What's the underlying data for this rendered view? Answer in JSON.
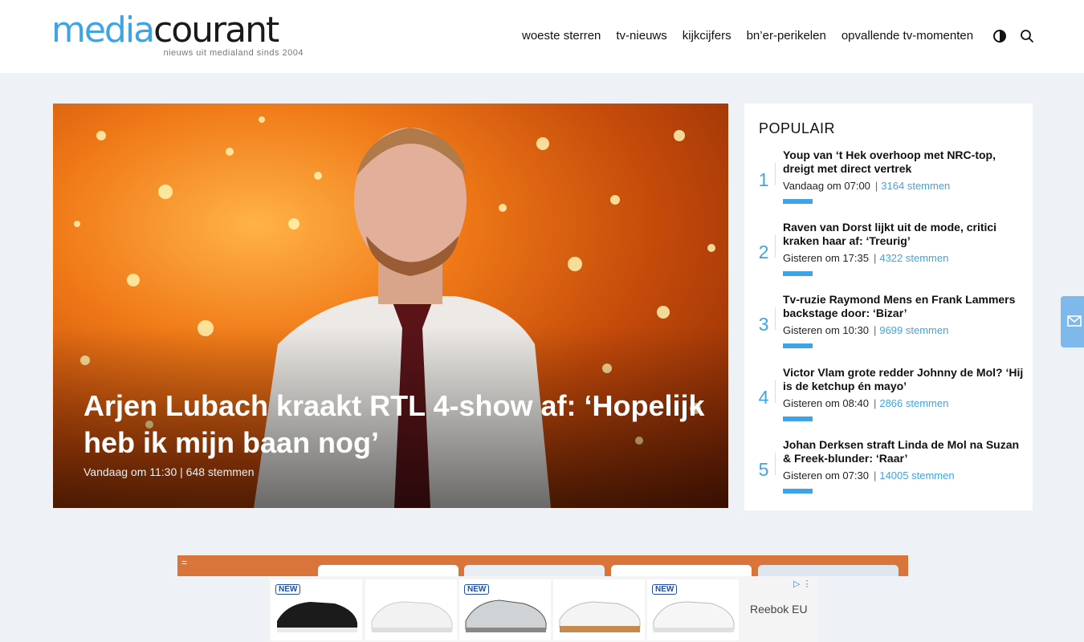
{
  "logo": {
    "part1": "media",
    "part2": "courant",
    "tagline": "nieuws uit medialand sinds 2004"
  },
  "nav": [
    "woeste sterren",
    "tv-nieuws",
    "kijkcijfers",
    "bn’er-perikelen",
    "opvallende tv-momenten"
  ],
  "icons": {
    "contrast": "contrast-toggle-icon",
    "search": "search-icon",
    "mail": "mail-icon"
  },
  "hero": {
    "title": "Arjen Lubach kraakt RTL 4-show af: ‘Hopelijk heb ik mijn baan nog’",
    "meta": "Vandaag om 11:30 | 648 stemmen"
  },
  "popular": {
    "heading": "POPULAIR",
    "items": [
      {
        "rank": "1",
        "title": "Youp van ‘t Hek overhoop met NRC-top, dreigt met direct vertrek",
        "time": "Vandaag om 07:00",
        "votes": "3164 stemmen"
      },
      {
        "rank": "2",
        "title": "Raven van Dorst lijkt uit de mode, critici kraken haar af: ‘Treurig’",
        "time": "Gisteren om 17:35",
        "votes": "4322 stemmen"
      },
      {
        "rank": "3",
        "title": "Tv-ruzie Raymond Mens en Frank Lammers backstage door: ‘Bizar’",
        "time": "Gisteren om 10:30",
        "votes": "9699 stemmen"
      },
      {
        "rank": "4",
        "title": "Victor Vlam grote redder Johnny de Mol? ‘Hij is de ketchup én mayo’",
        "time": "Gisteren om 08:40",
        "votes": "2866 stemmen"
      },
      {
        "rank": "5",
        "title": "Johan Derksen straft Linda de Mol na Suzan & Freek-blunder: ‘Raar’",
        "time": "Gisteren om 07:30",
        "votes": "14005 stemmen"
      }
    ]
  },
  "ad": {
    "brand": "Reebok EU",
    "badge": "NEW",
    "top_menu": "=",
    "choices": "▷ ⋮"
  },
  "colors": {
    "accent": "#3ea4e6",
    "ad_bg": "#d9743a"
  }
}
